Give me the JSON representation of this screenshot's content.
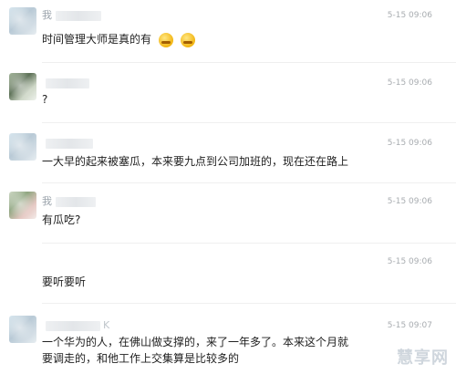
{
  "messages": [
    {
      "name": "我",
      "time": "5-15 09:06",
      "text": "时间管理大师是真的有",
      "emoji": [
        "smile-emoji",
        "smile-emoji"
      ]
    },
    {
      "name": "",
      "time": "5-15 09:06",
      "text": "?"
    },
    {
      "name": "",
      "time": "5-15 09:06",
      "text": "一大早的起来被塞瓜，本来要九点到公司加班的，现在还在路上"
    },
    {
      "name": "我",
      "time": "5-15 09:06",
      "text": "有瓜吃?"
    },
    {
      "name": "",
      "time": "5-15 09:06",
      "text": "要听要听"
    },
    {
      "name": "",
      "time": "5-15 09:07",
      "text": "一个华为的人，在佛山做支撑的，来了一年多了。本来这个月就要调走的，和他工作上交集算是比较多的"
    }
  ],
  "watermark": "慧享网"
}
